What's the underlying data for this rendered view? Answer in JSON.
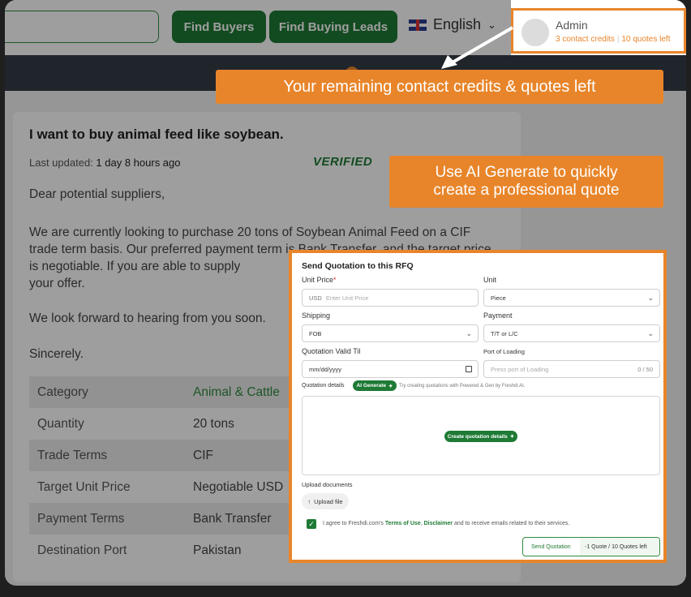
{
  "header": {
    "find_buyers": "Find Buyers",
    "find_buying_leads": "Find Buying Leads",
    "language": "English",
    "admin_name": "Admin",
    "contact_credits": "3 contact credits",
    "quotes_left": "10 quotes left"
  },
  "callouts": {
    "credits": "Your remaining contact credits & quotes left",
    "ai_line1": "Use AI Generate to quickly",
    "ai_line2": "create a professional quote"
  },
  "rfq": {
    "title": "I want to buy animal feed like soybean.",
    "updated_label": "Last updated:",
    "updated_value": "1 day 8 hours ago",
    "verified": "VERIFIED",
    "greeting": "Dear potential suppliers,",
    "para1": "We are currently looking to purchase 20 tons of Soybean Animal Feed on a CIF trade term basis. Our preferred payment term is Bank Transfer, and the target price is negotiable. If you are able to supply",
    "para1_end": "your offer.",
    "para2": "We look forward to hearing from you soon.",
    "sign": "Sincerely.",
    "specs": [
      {
        "label": "Category",
        "value": "Animal & Cattle"
      },
      {
        "label": "Quantity",
        "value": "20 tons"
      },
      {
        "label": "Trade Terms",
        "value": "CIF"
      },
      {
        "label": "Target Unit Price",
        "value": "Negotiable USD"
      },
      {
        "label": "Payment Terms",
        "value": "Bank Transfer"
      },
      {
        "label": "Destination Port",
        "value": "Pakistan"
      }
    ]
  },
  "form": {
    "title": "Send Quotation to this RFQ",
    "unit_price_label": "Unit Price",
    "unit_price_prefix": "USD",
    "unit_price_placeholder": "Enter Unit Price",
    "unit_label": "Unit",
    "unit_value": "Piece",
    "shipping_label": "Shipping",
    "shipping_value": "FOB",
    "payment_label": "Payment",
    "payment_value": "T/T or L/C",
    "valid_label": "Quotation Valid Til",
    "valid_placeholder": "mm/dd/yyyy",
    "port_label": "Port of Loading",
    "port_placeholder": "Press port of Loading",
    "port_counter": "0 / 50",
    "details_label": "Quotation details",
    "ai_generate": "AI Generate",
    "ai_hint": "Try creating quotations with Powered & Gen by Freshdi AI.",
    "create_details": "Create quotation details",
    "upload_label": "Upload documents",
    "upload_button": "Upload file",
    "agree_prefix": "I agree to Freshdi.com's",
    "terms": "Terms of Use",
    "disclaimer": "Disclaimer",
    "agree_and": "and",
    "agree_suffix": "to receive emails related to their services.",
    "send_label": "Send Quotation",
    "send_count": "-1 Quote / 10 Quotes left"
  },
  "colors": {
    "brand_green": "#1e7a35",
    "highlight_orange": "#e8852a",
    "nav_dark": "#343a46"
  }
}
